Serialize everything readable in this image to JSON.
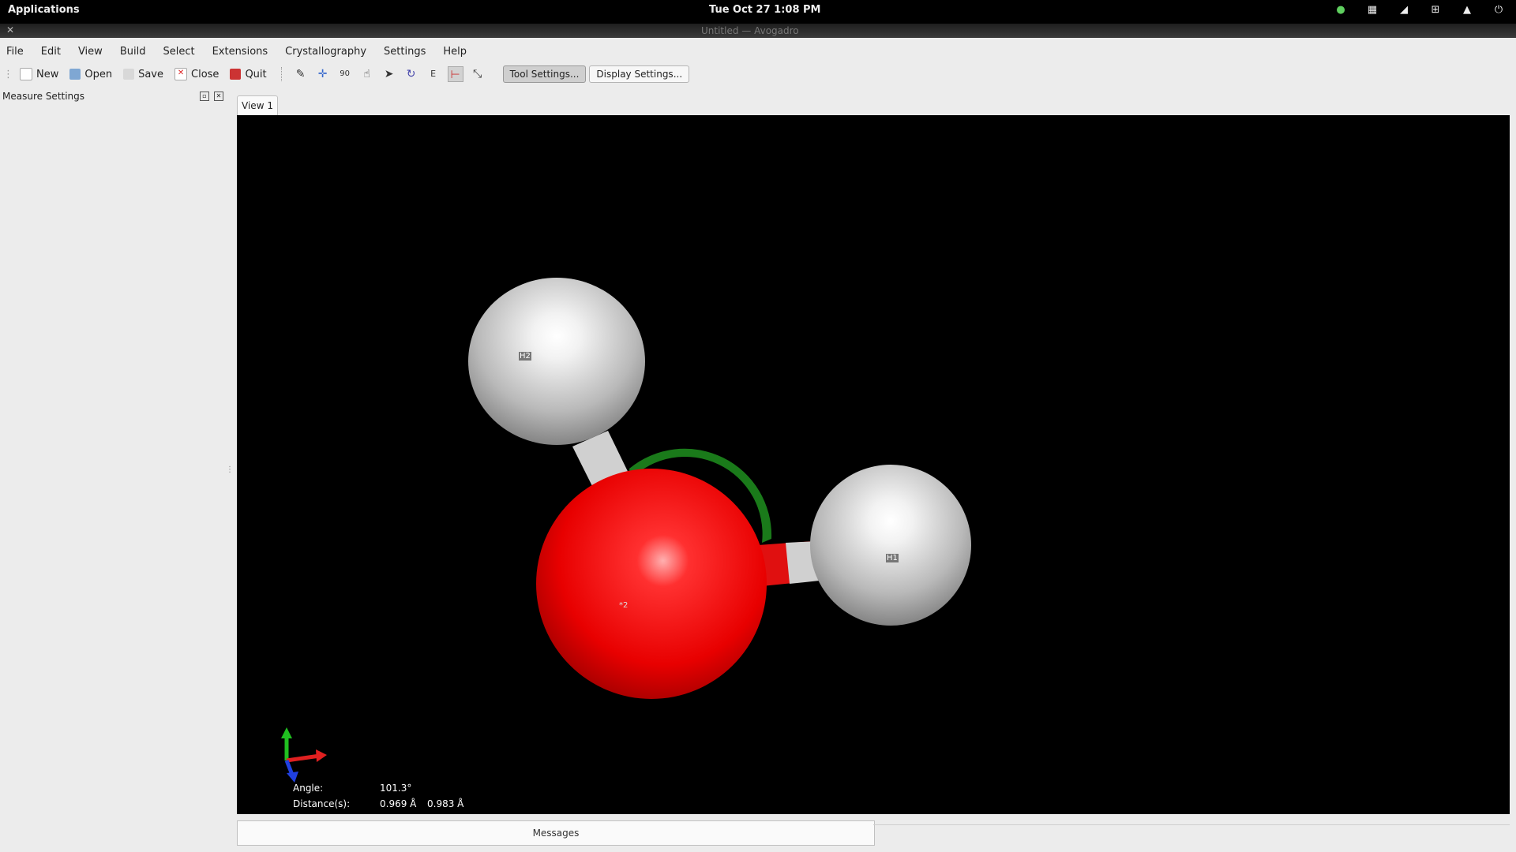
{
  "system_bar": {
    "applications_label": "Applications",
    "clock": "Tue Oct 27    1:08 PM",
    "tray_icons": [
      "chat-icon",
      "keyboard-icon",
      "volume-icon",
      "network-icon",
      "notification-icon",
      "power-icon"
    ]
  },
  "window": {
    "title": "Untitled — Avogadro"
  },
  "menu": [
    "File",
    "Edit",
    "View",
    "Build",
    "Select",
    "Extensions",
    "Crystallography",
    "Settings",
    "Help"
  ],
  "toolbar": {
    "new_label": "New",
    "open_label": "Open",
    "save_label": "Save",
    "close_label": "Close",
    "quit_label": "Quit",
    "tools": [
      "draw-tool-icon",
      "navigate-tool-icon",
      "bond-centric-tool-icon",
      "manipulate-tool-icon",
      "select-tool-icon",
      "auto-rotate-tool-icon",
      "auto-optimize-tool-icon",
      "measure-tool-icon",
      "align-tool-icon"
    ],
    "tool_settings_label": "Tool Settings...",
    "display_settings_label": "Display Settings..."
  },
  "sidebar": {
    "title": "Measure Settings"
  },
  "view_tab": "View 1",
  "molecule": {
    "atom_labels": [
      "H2",
      "H1",
      "*2"
    ],
    "colors": {
      "oxygen": "#ff1a1a",
      "hydrogen": "#e8e8e8",
      "angle_arc": "#1a8a1a"
    }
  },
  "measurement": {
    "angle_label": "Angle:",
    "angle_value": "101.3°",
    "distance_label": "Distance(s):",
    "distance_1": "0.969 Å",
    "distance_2": "0.983 Å"
  },
  "messages_label": "Messages"
}
